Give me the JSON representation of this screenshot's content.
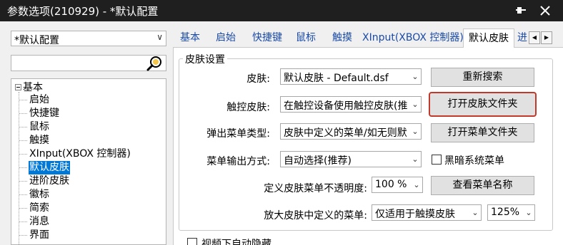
{
  "window": {
    "title": "参数选项(210929) - *默认配置",
    "icons": [
      "pin-icon",
      "close-icon"
    ]
  },
  "sidebar": {
    "profile_value": "*默认配置",
    "profile_arrow": "∨",
    "search_value": "",
    "tree_root": "基本",
    "tree_items": [
      "启始",
      "快捷键",
      "鼠标",
      "触摸",
      "XInput(XBOX 控制器)",
      "默认皮肤",
      "进阶皮肤",
      "徽标",
      "简索",
      "消息",
      "界面"
    ],
    "selected_index": 5
  },
  "tabs": {
    "items": [
      "基本",
      "启始",
      "快捷键",
      "鼠标",
      "触摸",
      "XInput(XBOX 控制器)",
      "默认皮肤",
      "进"
    ],
    "active_index": 6
  },
  "skin_settings": {
    "group_title": "皮肤设置",
    "skin_label": "皮肤:",
    "skin_value": "默认皮肤 - Default.dsf",
    "touch_skin_label": "触控皮肤:",
    "touch_skin_value": "在触控设备使用触控皮肤(推",
    "popup_type_label": "弹出菜单类型:",
    "popup_type_value": "皮肤中定义的菜单/如无则默",
    "menu_output_label": "菜单输出方式:",
    "menu_output_value": "自动选择(推荐)",
    "opacity_label": "定义皮肤菜单不透明度:",
    "opacity_value": "100 %",
    "zoom_menu_label": "放大皮肤中定义的菜单:",
    "zoom_menu_value": "仅适用于触摸皮肤",
    "zoom_percent_value": "125%",
    "dark_menu_label": "黑暗系统菜单",
    "dark_menu_checked": false,
    "rescan_button": "重新搜索",
    "open_skin_folder_button": "打开皮肤文件夹",
    "open_menu_folder_button": "打开菜单文件夹",
    "view_menu_names_button": "查看菜单名称"
  },
  "bottom": {
    "auto_hide_label": "视频下自动隐藏",
    "auto_hide_checked": false
  },
  "colors": {
    "titlebar": "#1f1f1f",
    "selection": "#0078d7",
    "highlight_border": "#c0392b"
  }
}
